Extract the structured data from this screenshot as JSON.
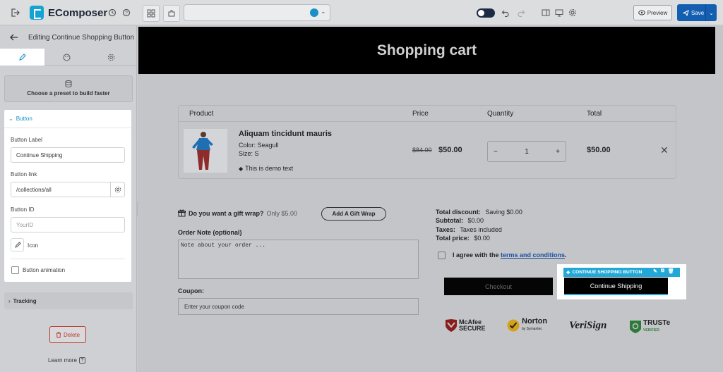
{
  "app": {
    "brand": "EComposer",
    "preview_label": "Preview",
    "save_label": "Save"
  },
  "sidebar": {
    "title": "Editing Continue Shopping Button",
    "preset_label": "Choose a preset to build faster",
    "section_title": "Button",
    "fields": {
      "label_title": "Button Label",
      "label_value": "Continue Shipping",
      "link_title": "Button link",
      "link_value": "/collections/all",
      "id_title": "Button ID",
      "id_placeholder": "YourID",
      "icon_label": "Icon",
      "animation_label": "Button animation"
    },
    "tracking_label": "Tracking",
    "delete_label": "Delete",
    "learn_more_label": "Learn more"
  },
  "page": {
    "title": "Shopping cart",
    "table_headers": [
      "Product",
      "Price",
      "Quantity",
      "Total"
    ],
    "item": {
      "name": "Aliquam tincidunt mauris",
      "color": "Color: Seagull",
      "size": "Size: S",
      "note": "This is demo text",
      "old_price": "$84.00",
      "price": "$50.00",
      "quantity": "1",
      "total": "$50.00"
    },
    "gift_text": "Do you want a gift wrap?",
    "gift_price": "Only $5.00",
    "gift_button": "Add A Gift Wrap",
    "order_note_label": "Order Note (optional)",
    "order_note_placeholder": "Note about your order ...",
    "coupon_label": "Coupon:",
    "coupon_placeholder": "Enter your coupon code",
    "summary": {
      "discount_label": "Total discount:",
      "discount_value": "Saving $0.00",
      "subtotal_label": "Subtotal:",
      "subtotal_value": "$0.00",
      "taxes_label": "Taxes:",
      "taxes_value": "Taxes included",
      "total_label": "Total price:",
      "total_value": "$0.00"
    },
    "agree_text": "I agree with the",
    "terms_link": "terms and conditions",
    "checkout_label": "Checkout",
    "selected_element_label": "CONTINUE SHOPPING BUTTON",
    "continue_label": "Continue Shipping",
    "trust": {
      "mcafee_1": "McAfee",
      "mcafee_2": "SECURE",
      "norton": "Norton",
      "norton_sub": "by Symantec",
      "verisign": "VeriSign",
      "truste": "TRUSTe",
      "truste_sub": "VERIFIED"
    }
  },
  "colors": {
    "accent": "#22a8d8",
    "save": "#135eb0",
    "delete": "#c0392b"
  }
}
